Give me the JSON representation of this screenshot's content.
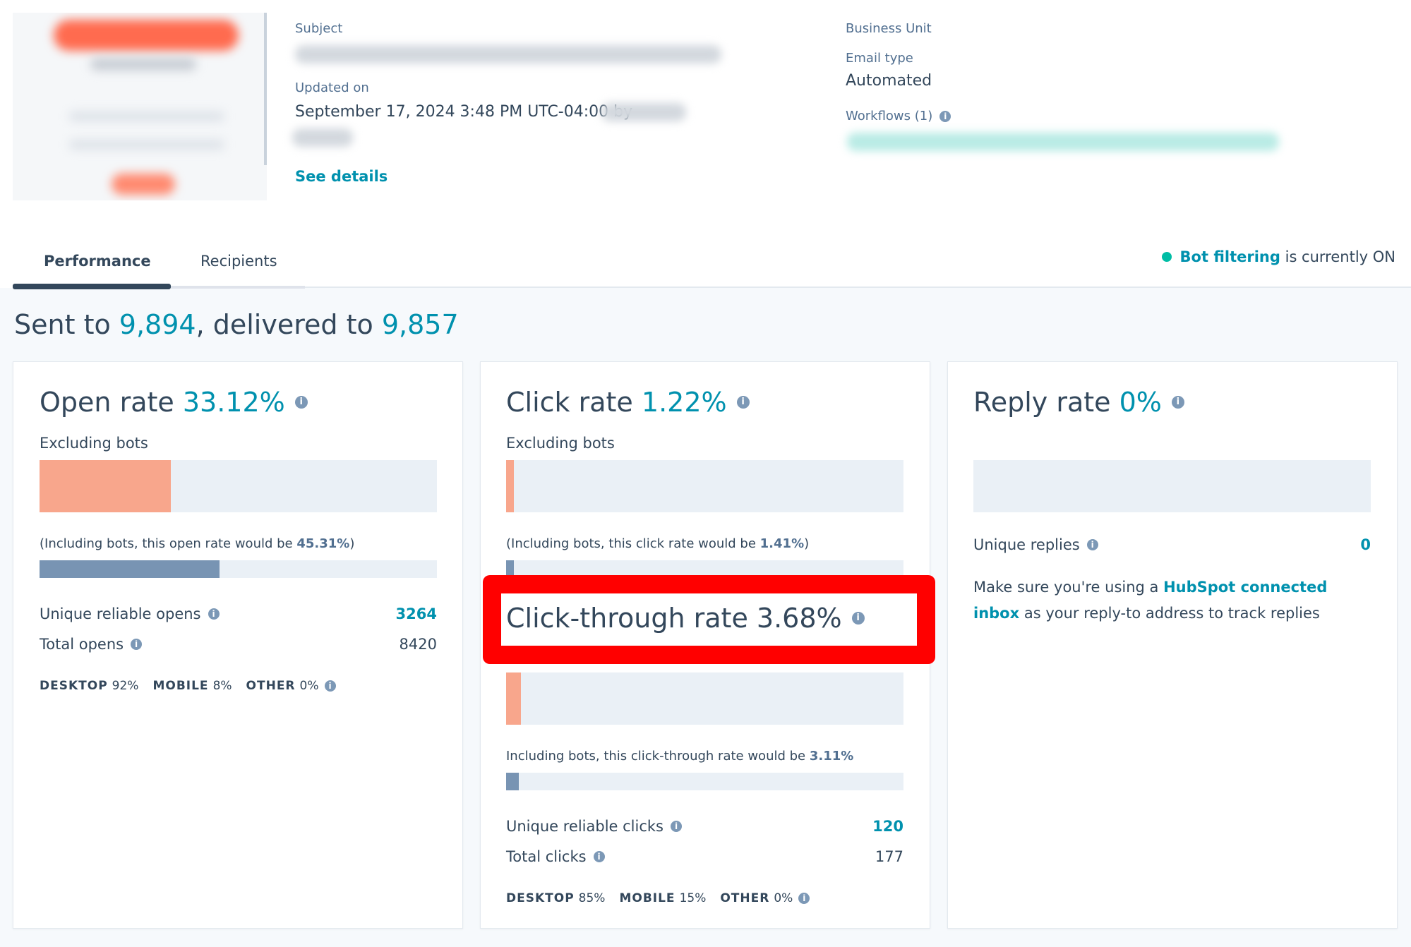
{
  "header": {
    "subject_label": "Subject",
    "updated_label": "Updated on",
    "updated_value": "September 17, 2024 3:48 PM UTC-04:00 by",
    "see_details": "See details",
    "business_unit_label": "Business Unit",
    "email_type_label": "Email type",
    "email_type_value": "Automated",
    "workflows_label": "Workflows (1)"
  },
  "tabs": [
    {
      "label": "Performance",
      "active": true
    },
    {
      "label": "Recipients",
      "active": false
    }
  ],
  "bot_filter": {
    "link": "Bot filtering",
    "text": "is currently ON"
  },
  "summary": {
    "prefix": "Sent to ",
    "sent": "9,894",
    "middle": ", delivered to ",
    "delivered": "9,857"
  },
  "open_card": {
    "title": "Open rate",
    "rate": "33.12%",
    "subtitle": "Excluding bots",
    "rate_fraction": 0.3312,
    "note_prefix": "(Including bots, this open rate would be ",
    "note_value": "45.31%",
    "note_suffix": ")",
    "incl_fraction": 0.4531,
    "stats": [
      {
        "label": "Unique reliable opens",
        "value": "3264"
      },
      {
        "label": "Total opens",
        "value": "8420"
      }
    ],
    "devices": [
      {
        "name": "DESKTOP",
        "value": "92%"
      },
      {
        "name": "MOBILE",
        "value": "8%"
      },
      {
        "name": "OTHER",
        "value": "0%"
      }
    ]
  },
  "click_card": {
    "title": "Click rate",
    "rate": "1.22%",
    "subtitle": "Excluding bots",
    "rate_fraction": 0.0122,
    "note_prefix": "(Including bots, this click rate would be ",
    "note_value": "1.41%",
    "note_suffix": ")",
    "incl_fraction": 0.0141,
    "ctr_title": "Click-through rate 3.68%",
    "ctr_fraction": 0.0368,
    "ctr_note_prefix": "Including bots, this click-through rate would be ",
    "ctr_note_value": "3.11%",
    "ctr_incl_fraction": 0.0311,
    "stats": [
      {
        "label": "Unique reliable clicks",
        "value": "120"
      },
      {
        "label": "Total clicks",
        "value": "177"
      }
    ],
    "devices": [
      {
        "name": "DESKTOP",
        "value": "85%"
      },
      {
        "name": "MOBILE",
        "value": "15%"
      },
      {
        "name": "OTHER",
        "value": "0%"
      }
    ]
  },
  "reply_card": {
    "title": "Reply rate",
    "rate": "0%",
    "rate_fraction": 0,
    "stat_label": "Unique replies",
    "stat_value": "0",
    "msg_prefix": "Make sure you're using a ",
    "msg_link": "HubSpot connected inbox",
    "msg_suffix": " as your reply-to address to track replies"
  },
  "colors": {
    "accent": "#0091ae",
    "highlight": "#ff0000",
    "bar_salmon": "#f8a68c",
    "bar_blue": "#7894b3",
    "track": "#eaf0f6"
  }
}
